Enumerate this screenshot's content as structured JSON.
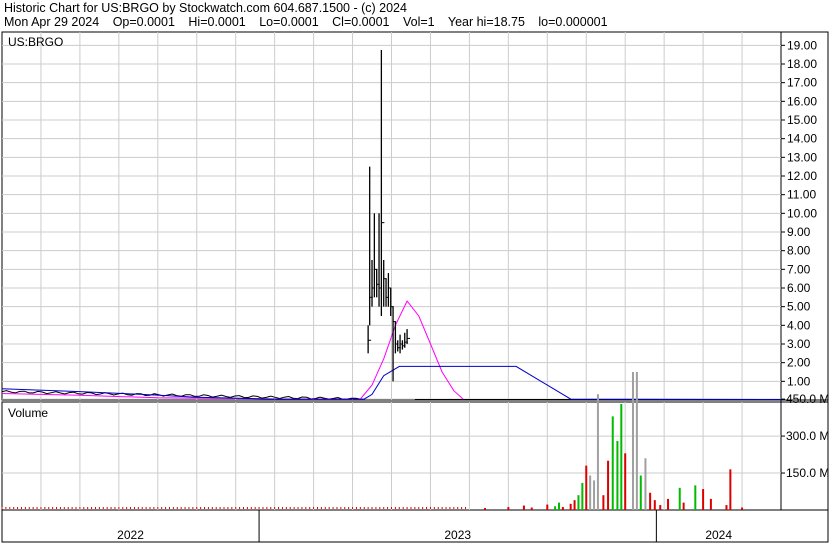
{
  "header": {
    "title": "Historic Chart for US:BRGO by Stockwatch.com 604.687.1500 - (c) 2024",
    "date": "Mon Apr 29 2024",
    "open": "Op=0.0001",
    "high": "Hi=0.0001",
    "low": "Lo=0.0001",
    "close": "Cl=0.0001",
    "volume": "Vol=1",
    "year_high": "Year hi=18.75",
    "year_low": "lo=0.000001"
  },
  "chart_data": [
    {
      "type": "line",
      "title": "US:BRGO",
      "ylim": [
        0,
        19.5
      ],
      "y_ticks": [
        "1.00",
        "2.00",
        "3.00",
        "4.00",
        "5.00",
        "6.00",
        "7.00",
        "8.00",
        "9.00",
        "10.00",
        "11.00",
        "12.00",
        "13.00",
        "14.00",
        "15.00",
        "16.00",
        "17.00",
        "18.00",
        "19.00"
      ],
      "x_labels": [
        "2022",
        "2023",
        "2024"
      ],
      "grid": true,
      "price_bars": [
        {
          "t": 0.47,
          "h": 4.0,
          "l": 2.5,
          "c": 3.2
        },
        {
          "t": 0.472,
          "h": 12.5,
          "l": 4.0,
          "c": 5.5
        },
        {
          "t": 0.475,
          "h": 7.5,
          "l": 5.0,
          "c": 6.0
        },
        {
          "t": 0.478,
          "h": 10.0,
          "l": 5.5,
          "c": 7.0
        },
        {
          "t": 0.481,
          "h": 7.0,
          "l": 5.5,
          "c": 6.2
        },
        {
          "t": 0.484,
          "h": 10.0,
          "l": 5.0,
          "c": 6.0
        },
        {
          "t": 0.487,
          "h": 18.75,
          "l": 4.5,
          "c": 9.5
        },
        {
          "t": 0.49,
          "h": 7.5,
          "l": 5.0,
          "c": 6.5
        },
        {
          "t": 0.493,
          "h": 6.5,
          "l": 5.0,
          "c": 5.5
        },
        {
          "t": 0.496,
          "h": 6.8,
          "l": 5.0,
          "c": 6.0
        },
        {
          "t": 0.499,
          "h": 6.0,
          "l": 4.5,
          "c": 5.0
        },
        {
          "t": 0.502,
          "h": 5.0,
          "l": 1.0,
          "c": 4.2
        },
        {
          "t": 0.505,
          "h": 4.2,
          "l": 2.5,
          "c": 3.0
        },
        {
          "t": 0.508,
          "h": 3.2,
          "l": 2.6,
          "c": 2.8
        },
        {
          "t": 0.511,
          "h": 3.5,
          "l": 2.5,
          "c": 3.0
        },
        {
          "t": 0.514,
          "h": 3.2,
          "l": 2.7,
          "c": 2.9
        },
        {
          "t": 0.517,
          "h": 3.6,
          "l": 2.8,
          "c": 3.1
        },
        {
          "t": 0.52,
          "h": 3.8,
          "l": 3.0,
          "c": 3.3
        }
      ],
      "series": [
        {
          "name": "",
          "color": "#ff00ff",
          "points": [
            [
              0.0,
              0.35
            ],
            [
              0.1,
              0.25
            ],
            [
              0.2,
              0.12
            ],
            [
              0.3,
              0.08
            ],
            [
              0.4,
              0.04
            ],
            [
              0.46,
              0.05
            ],
            [
              0.475,
              0.8
            ],
            [
              0.49,
              2.2
            ],
            [
              0.505,
              4.0
            ],
            [
              0.52,
              5.3
            ],
            [
              0.535,
              4.5
            ],
            [
              0.55,
              3.0
            ],
            [
              0.565,
              1.5
            ],
            [
              0.58,
              0.5
            ],
            [
              0.592,
              0.05
            ]
          ]
        },
        {
          "name": "",
          "color": "#0000cc",
          "points": [
            [
              0.0,
              0.6
            ],
            [
              0.1,
              0.45
            ],
            [
              0.18,
              0.3
            ],
            [
              0.25,
              0.15
            ],
            [
              0.35,
              0.05
            ],
            [
              0.465,
              0.05
            ],
            [
              0.475,
              0.3
            ],
            [
              0.49,
              1.3
            ],
            [
              0.51,
              1.8
            ],
            [
              0.66,
              1.8
            ],
            [
              0.7,
              0.8
            ],
            [
              0.73,
              0.05
            ],
            [
              1.0,
              0.02
            ]
          ]
        }
      ]
    },
    {
      "type": "bar",
      "title": "Volume",
      "ylim": [
        0,
        560
      ],
      "y_ticks": [
        "150.0 M",
        "300.0 M",
        "450.0 M"
      ],
      "bars": [
        {
          "t": 0.62,
          "v": 8,
          "c": "red"
        },
        {
          "t": 0.65,
          "v": 12,
          "c": "red"
        },
        {
          "t": 0.67,
          "v": 18,
          "c": "red"
        },
        {
          "t": 0.68,
          "v": 10,
          "c": "red"
        },
        {
          "t": 0.7,
          "v": 22,
          "c": "red"
        },
        {
          "t": 0.71,
          "v": 15,
          "c": "green"
        },
        {
          "t": 0.715,
          "v": 30,
          "c": "green"
        },
        {
          "t": 0.72,
          "v": 12,
          "c": "red"
        },
        {
          "t": 0.73,
          "v": 25,
          "c": "red"
        },
        {
          "t": 0.735,
          "v": 40,
          "c": "red"
        },
        {
          "t": 0.74,
          "v": 60,
          "c": "green"
        },
        {
          "t": 0.745,
          "v": 110,
          "c": "green"
        },
        {
          "t": 0.75,
          "v": 180,
          "c": "red"
        },
        {
          "t": 0.755,
          "v": 140,
          "c": "gray"
        },
        {
          "t": 0.76,
          "v": 120,
          "c": "gray"
        },
        {
          "t": 0.765,
          "v": 470,
          "c": "gray"
        },
        {
          "t": 0.772,
          "v": 60,
          "c": "red"
        },
        {
          "t": 0.778,
          "v": 200,
          "c": "red"
        },
        {
          "t": 0.784,
          "v": 380,
          "c": "green"
        },
        {
          "t": 0.79,
          "v": 280,
          "c": "green"
        },
        {
          "t": 0.795,
          "v": 430,
          "c": "green"
        },
        {
          "t": 0.8,
          "v": 230,
          "c": "red"
        },
        {
          "t": 0.81,
          "v": 600,
          "c": "gray"
        },
        {
          "t": 0.815,
          "v": 590,
          "c": "gray"
        },
        {
          "t": 0.82,
          "v": 140,
          "c": "green"
        },
        {
          "t": 0.826,
          "v": 210,
          "c": "gray"
        },
        {
          "t": 0.832,
          "v": 70,
          "c": "red"
        },
        {
          "t": 0.838,
          "v": 40,
          "c": "red"
        },
        {
          "t": 0.845,
          "v": 20,
          "c": "red"
        },
        {
          "t": 0.855,
          "v": 45,
          "c": "red"
        },
        {
          "t": 0.87,
          "v": 90,
          "c": "green"
        },
        {
          "t": 0.875,
          "v": 30,
          "c": "red"
        },
        {
          "t": 0.89,
          "v": 100,
          "c": "green"
        },
        {
          "t": 0.9,
          "v": 85,
          "c": "red"
        },
        {
          "t": 0.91,
          "v": 45,
          "c": "red"
        },
        {
          "t": 0.93,
          "v": 20,
          "c": "red"
        },
        {
          "t": 0.935,
          "v": 165,
          "c": "red"
        },
        {
          "t": 0.95,
          "v": 10,
          "c": "red"
        }
      ]
    }
  ],
  "colors": {
    "red": "#dd0000",
    "green": "#00bb00",
    "gray": "#a0a0a0",
    "grid": "#cccccc"
  }
}
